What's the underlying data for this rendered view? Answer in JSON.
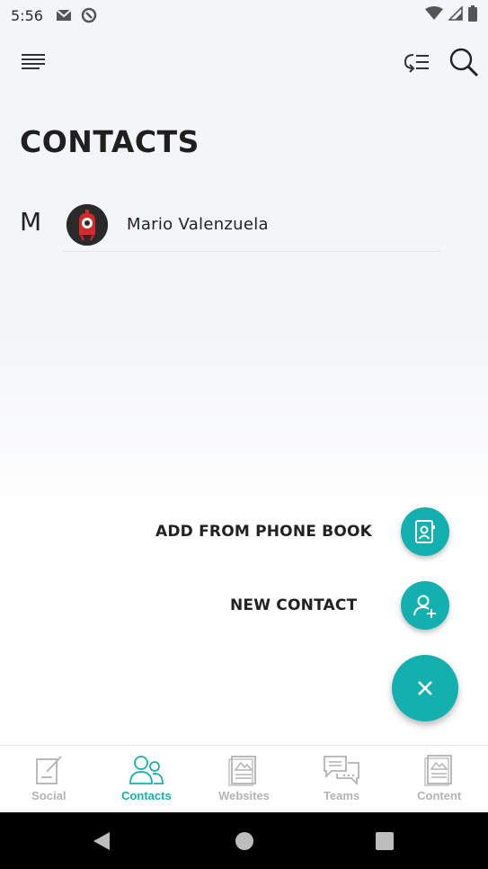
{
  "status_bar": {
    "time": "5:56",
    "icons": [
      "gmail-icon",
      "sync-icon",
      "wifi-icon",
      "signal-icon",
      "battery-icon"
    ]
  },
  "app_bar": {
    "menu_icon": "menu-icon",
    "sort_icon": "sort-icon",
    "search_icon": "search-icon"
  },
  "page": {
    "title": "CONTACTS"
  },
  "contacts": {
    "section_letter": "M",
    "items": [
      {
        "name": "Mario Valenzuela",
        "avatar_icon": "robot-avatar"
      }
    ]
  },
  "fab_menu": {
    "add_from_phone_book": "ADD FROM PHONE BOOK",
    "new_contact": "NEW CONTACT",
    "close_icon": "close-icon"
  },
  "bottom_nav": {
    "items": [
      {
        "label": "Social",
        "icon": "edit-icon",
        "active": false
      },
      {
        "label": "Contacts",
        "icon": "people-icon",
        "active": true
      },
      {
        "label": "Websites",
        "icon": "website-icon",
        "active": false
      },
      {
        "label": "Teams",
        "icon": "chat-icon",
        "active": false
      },
      {
        "label": "Content",
        "icon": "document-icon",
        "active": false
      }
    ]
  },
  "colors": {
    "accent": "#14b0b0",
    "inactive": "#b3b3b3",
    "background": "#f4f5f9"
  }
}
